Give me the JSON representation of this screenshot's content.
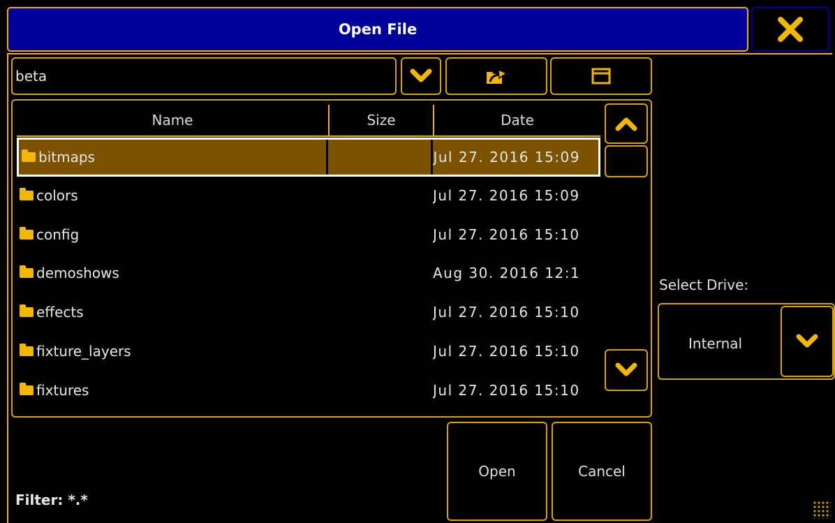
{
  "window": {
    "title": "Open File"
  },
  "path": {
    "value": "beta"
  },
  "toolbar": {
    "dropdown_icon": "chevron-down-icon",
    "up_icon": "folder-up-icon",
    "view_icon": "window-icon"
  },
  "table": {
    "columns": [
      "Name",
      "Size",
      "Date"
    ],
    "rows": [
      {
        "name": "bitmaps",
        "size": "",
        "date": "Jul 27. 2016 15:09",
        "selected": true
      },
      {
        "name": "colors",
        "size": "",
        "date": "Jul 27. 2016 15:09"
      },
      {
        "name": "config",
        "size": "",
        "date": "Jul 27. 2016 15:10"
      },
      {
        "name": "demoshows",
        "size": "",
        "date": "Aug 30. 2016 12:1"
      },
      {
        "name": "effects",
        "size": "",
        "date": "Jul 27. 2016 15:10"
      },
      {
        "name": "fixture_layers",
        "size": "",
        "date": "Jul 27. 2016 15:10"
      },
      {
        "name": "fixtures",
        "size": "",
        "date": "Jul 27. 2016 15:10"
      }
    ]
  },
  "drive": {
    "label": "Select Drive:",
    "value": "Internal"
  },
  "actions": {
    "open": "Open",
    "cancel": "Cancel"
  },
  "filter": {
    "label": "Filter: *.*"
  },
  "colors": {
    "accent": "#f0b000",
    "title_bg": "#00009c",
    "selected_row": "#7a5200",
    "bg": "#000000"
  }
}
